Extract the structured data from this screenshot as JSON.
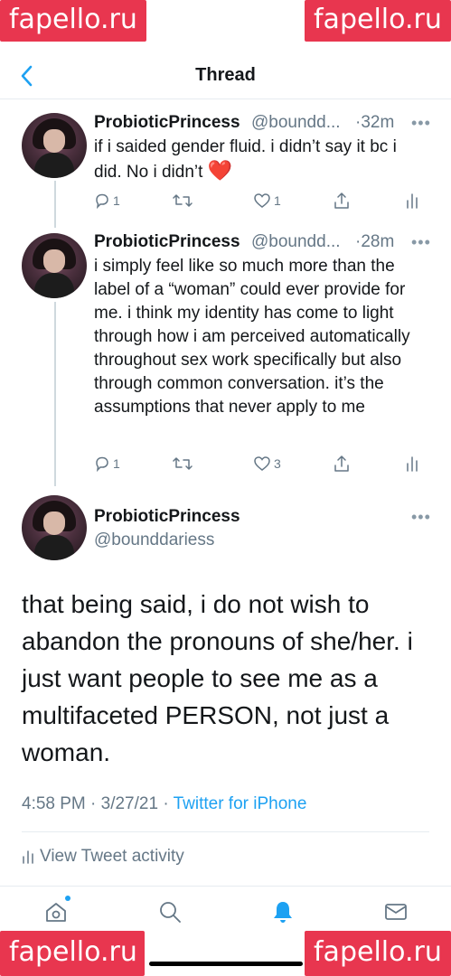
{
  "watermark": "fapello.ru",
  "header": {
    "title": "Thread"
  },
  "tweets": [
    {
      "name": "ProbioticPrincess",
      "handle": "@boundd...",
      "time": "·32m",
      "text": "if i saided gender fluid. i didn’t say it bc i did. No i didn’t",
      "emoji": "❤️",
      "replies": "1",
      "likes": "1"
    },
    {
      "name": "ProbioticPrincess",
      "handle": "@boundd...",
      "time": "·28m",
      "text": "i simply feel like so much more than the label of a “woman” could ever provide for me. i think my identity has come to light through how i am perceived automatically throughout sex work specifically but also through common conversation. it’s the assumptions that never apply to me",
      "replies": "1",
      "likes": "3"
    }
  ],
  "main": {
    "name": "ProbioticPrincess",
    "handle": "@bounddariess",
    "text": "that being said, i do not wish to abandon the pronouns of she/her. i just want people to see me as a multifaceted PERSON, not just a woman.",
    "time": "4:58 PM · 3/27/21 · ",
    "source": "Twitter for iPhone",
    "activity": "View Tweet activity"
  },
  "more_glyph": "•••",
  "icons": {
    "back": "chevron-left-icon",
    "reply": "reply-icon",
    "retweet": "retweet-icon",
    "like": "heart-icon",
    "share": "share-icon",
    "analytics": "analytics-icon",
    "tabs": [
      "home-icon",
      "search-icon",
      "notifications-icon",
      "messages-icon"
    ]
  },
  "colors": {
    "accent": "#1da1f2",
    "text": "#14171a",
    "muted": "#657786",
    "watermark": "#e8364f"
  }
}
